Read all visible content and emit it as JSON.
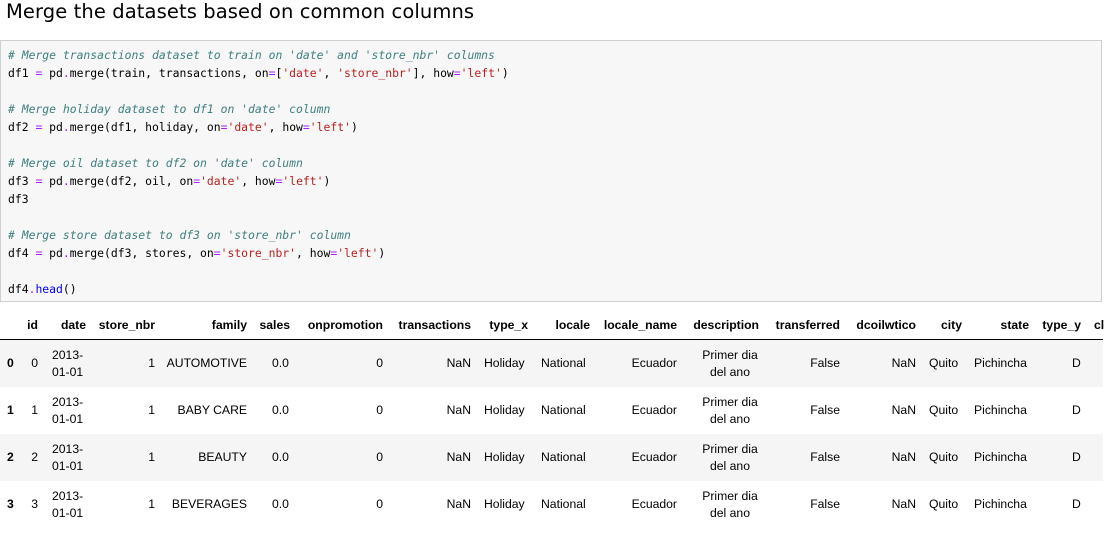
{
  "heading": "Merge the datasets based on common columns",
  "code": [
    [
      [
        "cm",
        "# Merge transactions dataset to train on 'date' and 'store_nbr' columns"
      ]
    ],
    [
      [
        "t",
        "df1 "
      ],
      [
        "op",
        "="
      ],
      [
        "t",
        " pd"
      ],
      [
        "op",
        "."
      ],
      [
        "t",
        "merge(train, transactions, on"
      ],
      [
        "op",
        "="
      ],
      [
        "t",
        "["
      ],
      [
        "st",
        "'date'"
      ],
      [
        "t",
        ", "
      ],
      [
        "st",
        "'store_nbr'"
      ],
      [
        "t",
        "], how"
      ],
      [
        "op",
        "="
      ],
      [
        "st",
        "'left'"
      ],
      [
        "t",
        ")"
      ]
    ],
    [],
    [
      [
        "cm",
        "# Merge holiday dataset to df1 on 'date' column"
      ]
    ],
    [
      [
        "t",
        "df2 "
      ],
      [
        "op",
        "="
      ],
      [
        "t",
        " pd"
      ],
      [
        "op",
        "."
      ],
      [
        "t",
        "merge(df1, holiday, on"
      ],
      [
        "op",
        "="
      ],
      [
        "st",
        "'date'"
      ],
      [
        "t",
        ", how"
      ],
      [
        "op",
        "="
      ],
      [
        "st",
        "'left'"
      ],
      [
        "t",
        ")"
      ]
    ],
    [],
    [
      [
        "cm",
        "# Merge oil dataset to df2 on 'date' column"
      ]
    ],
    [
      [
        "t",
        "df3 "
      ],
      [
        "op",
        "="
      ],
      [
        "t",
        " pd"
      ],
      [
        "op",
        "."
      ],
      [
        "t",
        "merge(df2, oil, on"
      ],
      [
        "op",
        "="
      ],
      [
        "st",
        "'date'"
      ],
      [
        "t",
        ", how"
      ],
      [
        "op",
        "="
      ],
      [
        "st",
        "'left'"
      ],
      [
        "t",
        ")"
      ]
    ],
    [
      [
        "t",
        "df3"
      ]
    ],
    [],
    [
      [
        "cm",
        "# Merge store dataset to df3 on 'store_nbr' column"
      ]
    ],
    [
      [
        "t",
        "df4 "
      ],
      [
        "op",
        "="
      ],
      [
        "t",
        " pd"
      ],
      [
        "op",
        "."
      ],
      [
        "t",
        "merge(df3, stores, on"
      ],
      [
        "op",
        "="
      ],
      [
        "st",
        "'store_nbr'"
      ],
      [
        "t",
        ", how"
      ],
      [
        "op",
        "="
      ],
      [
        "st",
        "'left'"
      ],
      [
        "t",
        ")"
      ]
    ],
    [],
    [
      [
        "t",
        "df4"
      ],
      [
        "op",
        "."
      ],
      [
        "fn",
        "head"
      ],
      [
        "t",
        "()"
      ]
    ]
  ],
  "table": {
    "columns": [
      "id",
      "date",
      "store_nbr",
      "family",
      "sales",
      "onpromotion",
      "transactions",
      "type_x",
      "locale",
      "locale_name",
      "description",
      "transferred",
      "dcoilwtico",
      "city",
      "state",
      "type_y",
      "cl"
    ],
    "rows": [
      {
        "index": "0",
        "id": "0",
        "date1": "2013-",
        "date2": "01-01",
        "store_nbr": "1",
        "family": "AUTOMOTIVE",
        "sales": "0.0",
        "onpromotion": "0",
        "transactions": "NaN",
        "type_x": "Holiday",
        "locale": "National",
        "locale_name": "Ecuador",
        "desc1": "Primer dia",
        "desc2": "del ano",
        "transferred": "False",
        "dcoilwtico": "NaN",
        "city": "Quito",
        "state": "Pichincha",
        "type_y": "D"
      },
      {
        "index": "1",
        "id": "1",
        "date1": "2013-",
        "date2": "01-01",
        "store_nbr": "1",
        "family": "BABY CARE",
        "sales": "0.0",
        "onpromotion": "0",
        "transactions": "NaN",
        "type_x": "Holiday",
        "locale": "National",
        "locale_name": "Ecuador",
        "desc1": "Primer dia",
        "desc2": "del ano",
        "transferred": "False",
        "dcoilwtico": "NaN",
        "city": "Quito",
        "state": "Pichincha",
        "type_y": "D"
      },
      {
        "index": "2",
        "id": "2",
        "date1": "2013-",
        "date2": "01-01",
        "store_nbr": "1",
        "family": "BEAUTY",
        "sales": "0.0",
        "onpromotion": "0",
        "transactions": "NaN",
        "type_x": "Holiday",
        "locale": "National",
        "locale_name": "Ecuador",
        "desc1": "Primer dia",
        "desc2": "del ano",
        "transferred": "False",
        "dcoilwtico": "NaN",
        "city": "Quito",
        "state": "Pichincha",
        "type_y": "D"
      },
      {
        "index": "3",
        "id": "3",
        "date1": "2013-",
        "date2": "01-01",
        "store_nbr": "1",
        "family": "BEVERAGES",
        "sales": "0.0",
        "onpromotion": "0",
        "transactions": "NaN",
        "type_x": "Holiday",
        "locale": "National",
        "locale_name": "Ecuador",
        "desc1": "Primer dia",
        "desc2": "del ano",
        "transferred": "False",
        "dcoilwtico": "NaN",
        "city": "Quito",
        "state": "Pichincha",
        "type_y": "D"
      }
    ]
  }
}
